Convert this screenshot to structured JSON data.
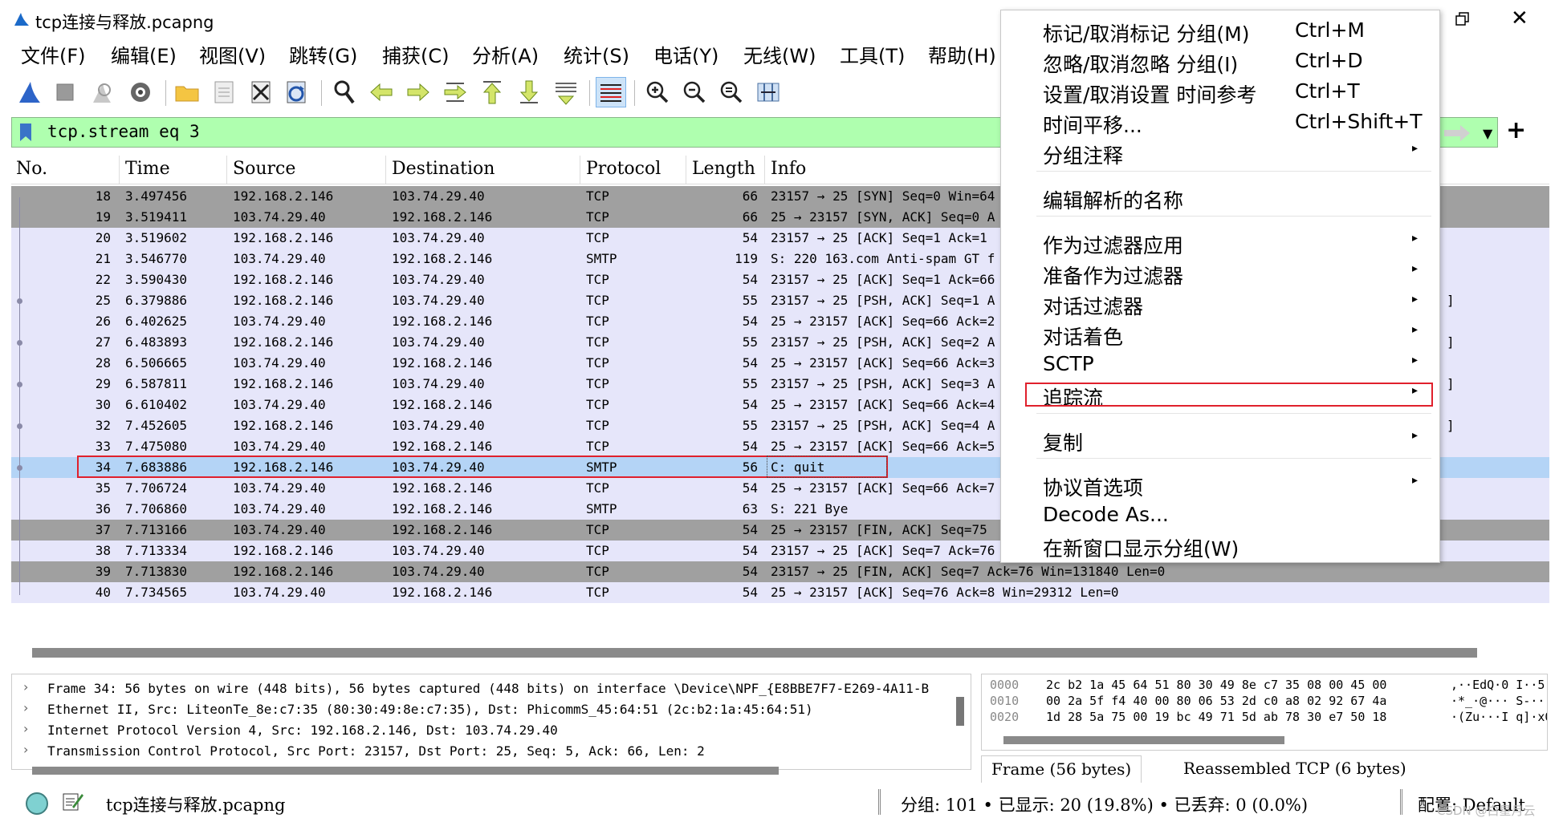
{
  "window": {
    "title": "tcp连接与释放.pcapng",
    "close_glyph": "✕"
  },
  "menubar": [
    "文件(F)",
    "编辑(E)",
    "视图(V)",
    "跳转(G)",
    "捕获(C)",
    "分析(A)",
    "统计(S)",
    "电话(Y)",
    "无线(W)",
    "工具(T)",
    "帮助(H)"
  ],
  "toolbar": {
    "icons": [
      "shark-fin-start-icon",
      "stop-capture-icon",
      "restart-capture-icon",
      "capture-options-icon",
      "open-file-icon",
      "save-file-icon",
      "close-file-icon",
      "reload-file-icon",
      "find-packet-icon",
      "go-back-icon",
      "go-forward-icon",
      "go-to-packet-icon",
      "go-first-icon",
      "go-last-icon",
      "autoscroll-icon",
      "colorize-icon",
      "zoom-in-icon",
      "zoom-out-icon",
      "normal-size-icon",
      "resize-columns-icon"
    ]
  },
  "filter": {
    "value": "tcp.stream eq 3",
    "background": "#afffaf",
    "add_button": "+"
  },
  "packet_list": {
    "columns": [
      "No.",
      "Time",
      "Source",
      "Destination",
      "Protocol",
      "Length",
      "Info"
    ],
    "rows": [
      {
        "no": "18",
        "time": "3.497456",
        "src": "192.168.2.146",
        "dst": "103.74.29.40",
        "proto": "TCP",
        "len": "66",
        "info": "23157 → 25 [SYN] Seq=0 Win=64",
        "style": "dark"
      },
      {
        "no": "19",
        "time": "3.519411",
        "src": "103.74.29.40",
        "dst": "192.168.2.146",
        "proto": "TCP",
        "len": "66",
        "info": "25 → 23157 [SYN, ACK] Seq=0 A",
        "style": "dark"
      },
      {
        "no": "20",
        "time": "3.519602",
        "src": "192.168.2.146",
        "dst": "103.74.29.40",
        "proto": "TCP",
        "len": "54",
        "info": "23157 → 25 [ACK] Seq=1 Ack=1",
        "style": "light"
      },
      {
        "no": "21",
        "time": "3.546770",
        "src": "103.74.29.40",
        "dst": "192.168.2.146",
        "proto": "SMTP",
        "len": "119",
        "info": "S: 220 163.com Anti-spam GT f",
        "style": "light"
      },
      {
        "no": "22",
        "time": "3.590430",
        "src": "192.168.2.146",
        "dst": "103.74.29.40",
        "proto": "TCP",
        "len": "54",
        "info": "23157 → 25 [ACK] Seq=1 Ack=66",
        "style": "light"
      },
      {
        "no": "25",
        "time": "6.379886",
        "src": "192.168.2.146",
        "dst": "103.74.29.40",
        "proto": "TCP",
        "len": "55",
        "info": "23157 → 25 [PSH, ACK] Seq=1 A",
        "style": "light",
        "tail": "]"
      },
      {
        "no": "26",
        "time": "6.402625",
        "src": "103.74.29.40",
        "dst": "192.168.2.146",
        "proto": "TCP",
        "len": "54",
        "info": "25 → 23157 [ACK] Seq=66 Ack=2",
        "style": "light"
      },
      {
        "no": "27",
        "time": "6.483893",
        "src": "192.168.2.146",
        "dst": "103.74.29.40",
        "proto": "TCP",
        "len": "55",
        "info": "23157 → 25 [PSH, ACK] Seq=2 A",
        "style": "light",
        "tail": "]"
      },
      {
        "no": "28",
        "time": "6.506665",
        "src": "103.74.29.40",
        "dst": "192.168.2.146",
        "proto": "TCP",
        "len": "54",
        "info": "25 → 23157 [ACK] Seq=66 Ack=3",
        "style": "light"
      },
      {
        "no": "29",
        "time": "6.587811",
        "src": "192.168.2.146",
        "dst": "103.74.29.40",
        "proto": "TCP",
        "len": "55",
        "info": "23157 → 25 [PSH, ACK] Seq=3 A",
        "style": "light",
        "tail": "]"
      },
      {
        "no": "30",
        "time": "6.610402",
        "src": "103.74.29.40",
        "dst": "192.168.2.146",
        "proto": "TCP",
        "len": "54",
        "info": "25 → 23157 [ACK] Seq=66 Ack=4",
        "style": "light"
      },
      {
        "no": "32",
        "time": "7.452605",
        "src": "192.168.2.146",
        "dst": "103.74.29.40",
        "proto": "TCP",
        "len": "55",
        "info": "23157 → 25 [PSH, ACK] Seq=4 A",
        "style": "light",
        "tail": "]"
      },
      {
        "no": "33",
        "time": "7.475080",
        "src": "103.74.29.40",
        "dst": "192.168.2.146",
        "proto": "TCP",
        "len": "54",
        "info": "25 → 23157 [ACK] Seq=66 Ack=5",
        "style": "light"
      },
      {
        "no": "34",
        "time": "7.683886",
        "src": "192.168.2.146",
        "dst": "103.74.29.40",
        "proto": "SMTP",
        "len": "56",
        "info": "C: quit",
        "style": "sel"
      },
      {
        "no": "35",
        "time": "7.706724",
        "src": "103.74.29.40",
        "dst": "192.168.2.146",
        "proto": "TCP",
        "len": "54",
        "info": "25 → 23157 [ACK] Seq=66 Ack=7",
        "style": "light"
      },
      {
        "no": "36",
        "time": "7.706860",
        "src": "103.74.29.40",
        "dst": "192.168.2.146",
        "proto": "SMTP",
        "len": "63",
        "info": "S: 221 Bye",
        "style": "light"
      },
      {
        "no": "37",
        "time": "7.713166",
        "src": "103.74.29.40",
        "dst": "192.168.2.146",
        "proto": "TCP",
        "len": "54",
        "info": "25 → 23157 [FIN, ACK] Seq=75",
        "style": "dark"
      },
      {
        "no": "38",
        "time": "7.713334",
        "src": "192.168.2.146",
        "dst": "103.74.29.40",
        "proto": "TCP",
        "len": "54",
        "info": "23157 → 25 [ACK] Seq=7 Ack=76",
        "style": "light"
      },
      {
        "no": "39",
        "time": "7.713830",
        "src": "192.168.2.146",
        "dst": "103.74.29.40",
        "proto": "TCP",
        "len": "54",
        "info": "23157 → 25 [FIN, ACK] Seq=7 Ack=76 Win=131840 Len=0",
        "style": "dark"
      },
      {
        "no": "40",
        "time": "7.734565",
        "src": "103.74.29.40",
        "dst": "192.168.2.146",
        "proto": "TCP",
        "len": "54",
        "info": "25 → 23157 [ACK] Seq=76 Ack=8 Win=29312 Len=0",
        "style": "light"
      }
    ],
    "colors": {
      "dark": "#a0a0a0",
      "light": "#e6e6fa",
      "selected": "#b4d4f6"
    }
  },
  "details": [
    "Frame 34: 56 bytes on wire (448 bits), 56 bytes captured (448 bits) on interface \\Device\\NPF_{E8BBE7F7-E269-4A11-B",
    "Ethernet II, Src: LiteonTe_8e:c7:35 (80:30:49:8e:c7:35), Dst: PhicommS_45:64:51 (2c:b2:1a:45:64:51)",
    "Internet Protocol Version 4, Src: 192.168.2.146, Dst: 103.74.29.40",
    "Transmission Control Protocol, Src Port: 23157, Dst Port: 25, Seq: 5, Ack: 66, Len: 2"
  ],
  "hex": [
    {
      "off": "0000",
      "hex": "2c b2 1a 45 64 51 80 30  49 8e c7 35 08 00 45 00",
      "ascii": ",··EdQ·0 I··5··E·"
    },
    {
      "off": "0010",
      "hex": "00 2a 5f f4 40 00 80 06  53 2d c0 a8 02 92 67 4a",
      "ascii": "·*_·@··· S-····gJ"
    },
    {
      "off": "0020",
      "hex": "1d 28 5a 75 00 19 bc 49  71 5d ab 78 30 e7 50 18",
      "ascii": "·(Zu···I q]·x0·P·"
    }
  ],
  "hex_tabs": [
    "Frame (56 bytes)",
    "Reassembled TCP (6 bytes)"
  ],
  "statusbar": {
    "file": "tcp连接与释放.pcapng",
    "stats": "分组: 101 • 已显示: 20 (19.8%) • 已丢弃: 0 (0.0%)",
    "profile": "配置: Default",
    "watermark": "CSDN @白星月云"
  },
  "context_menu": {
    "items": [
      {
        "label": "标记/取消标记 分组(M)",
        "shortcut": "Ctrl+M"
      },
      {
        "label": "忽略/取消忽略 分组(I)",
        "shortcut": "Ctrl+D"
      },
      {
        "label": "设置/取消设置 时间参考",
        "shortcut": "Ctrl+T"
      },
      {
        "label": "时间平移...",
        "shortcut": "Ctrl+Shift+T"
      },
      {
        "label": "分组注释",
        "submenu": true
      },
      {
        "label": "编辑解析的名称"
      },
      {
        "label": "作为过滤器应用",
        "submenu": true
      },
      {
        "label": "准备作为过滤器",
        "submenu": true
      },
      {
        "label": "对话过滤器",
        "submenu": true
      },
      {
        "label": "对话着色",
        "submenu": true
      },
      {
        "label": "SCTP",
        "submenu": true
      },
      {
        "label": "追踪流",
        "submenu": true
      },
      {
        "label": "复制",
        "submenu": true
      },
      {
        "label": "协议首选项",
        "submenu": true
      },
      {
        "label": "Decode As..."
      },
      {
        "label": "在新窗口显示分组(W)"
      }
    ],
    "submenu_arrow": "▸",
    "highlight_color": "#e0202c"
  }
}
